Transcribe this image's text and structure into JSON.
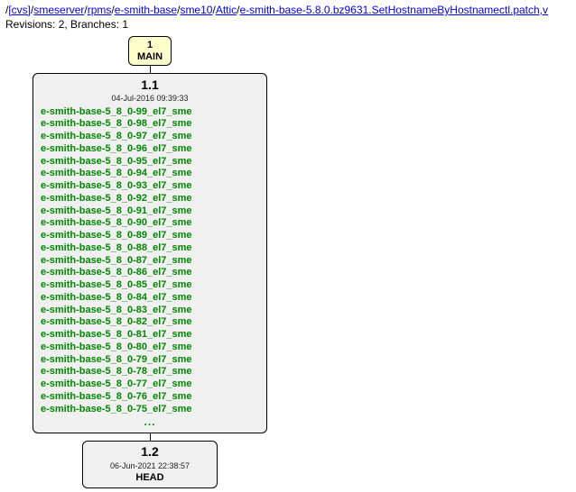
{
  "path": {
    "segments": [
      {
        "text": "/"
      },
      {
        "text": "[cvs]",
        "link": true
      },
      {
        "text": "/"
      },
      {
        "text": "smeserver",
        "link": true
      },
      {
        "text": "/"
      },
      {
        "text": "rpms",
        "link": true
      },
      {
        "text": "/"
      },
      {
        "text": "e-smith-base",
        "link": true
      },
      {
        "text": "/"
      },
      {
        "text": "sme10",
        "link": true
      },
      {
        "text": "/"
      },
      {
        "text": "Attic",
        "link": true
      },
      {
        "text": "/"
      },
      {
        "text": "e-smith-base-5.8.0.bz9631.SetHostnameByHostnamectl.patch,v",
        "link": true
      }
    ]
  },
  "meta": "Revisions: 2, Branches: 1",
  "branch": {
    "num": "1",
    "name": "MAIN"
  },
  "rev1": {
    "ver": "1.1",
    "date": "04-Jul-2016 09:39:33",
    "tags": [
      "e-smith-base-5_8_0-99_el7_sme",
      "e-smith-base-5_8_0-98_el7_sme",
      "e-smith-base-5_8_0-97_el7_sme",
      "e-smith-base-5_8_0-96_el7_sme",
      "e-smith-base-5_8_0-95_el7_sme",
      "e-smith-base-5_8_0-94_el7_sme",
      "e-smith-base-5_8_0-93_el7_sme",
      "e-smith-base-5_8_0-92_el7_sme",
      "e-smith-base-5_8_0-91_el7_sme",
      "e-smith-base-5_8_0-90_el7_sme",
      "e-smith-base-5_8_0-89_el7_sme",
      "e-smith-base-5_8_0-88_el7_sme",
      "e-smith-base-5_8_0-87_el7_sme",
      "e-smith-base-5_8_0-86_el7_sme",
      "e-smith-base-5_8_0-85_el7_sme",
      "e-smith-base-5_8_0-84_el7_sme",
      "e-smith-base-5_8_0-83_el7_sme",
      "e-smith-base-5_8_0-82_el7_sme",
      "e-smith-base-5_8_0-81_el7_sme",
      "e-smith-base-5_8_0-80_el7_sme",
      "e-smith-base-5_8_0-79_el7_sme",
      "e-smith-base-5_8_0-78_el7_sme",
      "e-smith-base-5_8_0-77_el7_sme",
      "e-smith-base-5_8_0-76_el7_sme",
      "e-smith-base-5_8_0-75_el7_sme"
    ],
    "ellipsis": "..."
  },
  "rev2": {
    "ver": "1.2",
    "date": "06-Jun-2021 22:38:57",
    "head": "HEAD"
  }
}
